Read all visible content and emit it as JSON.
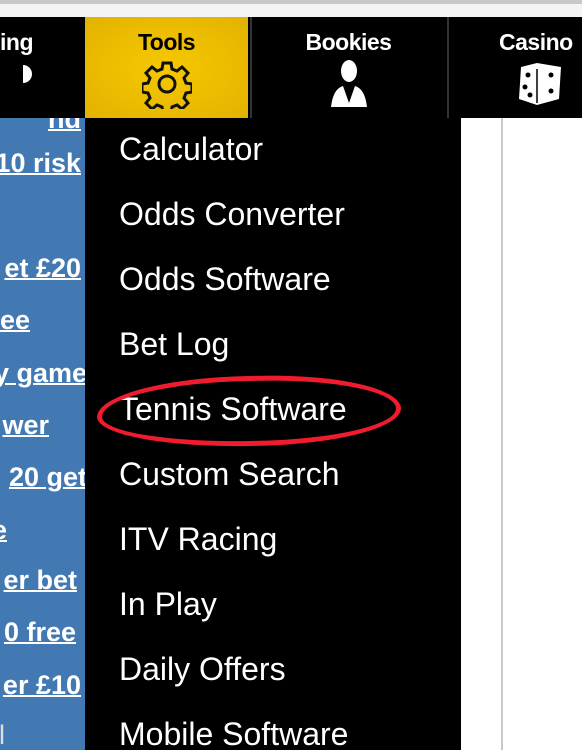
{
  "nav": {
    "tabs": [
      {
        "label": "ing",
        "icon": "partial-icon"
      },
      {
        "label": "Tools",
        "icon": "gear-icon",
        "active": true
      },
      {
        "label": "Bookies",
        "icon": "businessman-icon"
      },
      {
        "label": "Casino",
        "icon": "dice-icon"
      }
    ],
    "active_color": "#f2c400"
  },
  "left_links": [
    "nd",
    "10 risk",
    "et £20",
    "ee",
    "y game",
    "wer",
    "20 get",
    "e",
    "er bet",
    "0 free",
    "er £10",
    "l"
  ],
  "dropdown": {
    "items": [
      "Calculator",
      "Odds Converter",
      "Odds Software",
      "Bet Log",
      "Tennis Software",
      "Custom Search",
      "ITV Racing",
      "In Play",
      "Daily Offers",
      "Mobile Software"
    ],
    "highlighted": "Tennis Software",
    "highlight_color": "#ee1c2e"
  }
}
